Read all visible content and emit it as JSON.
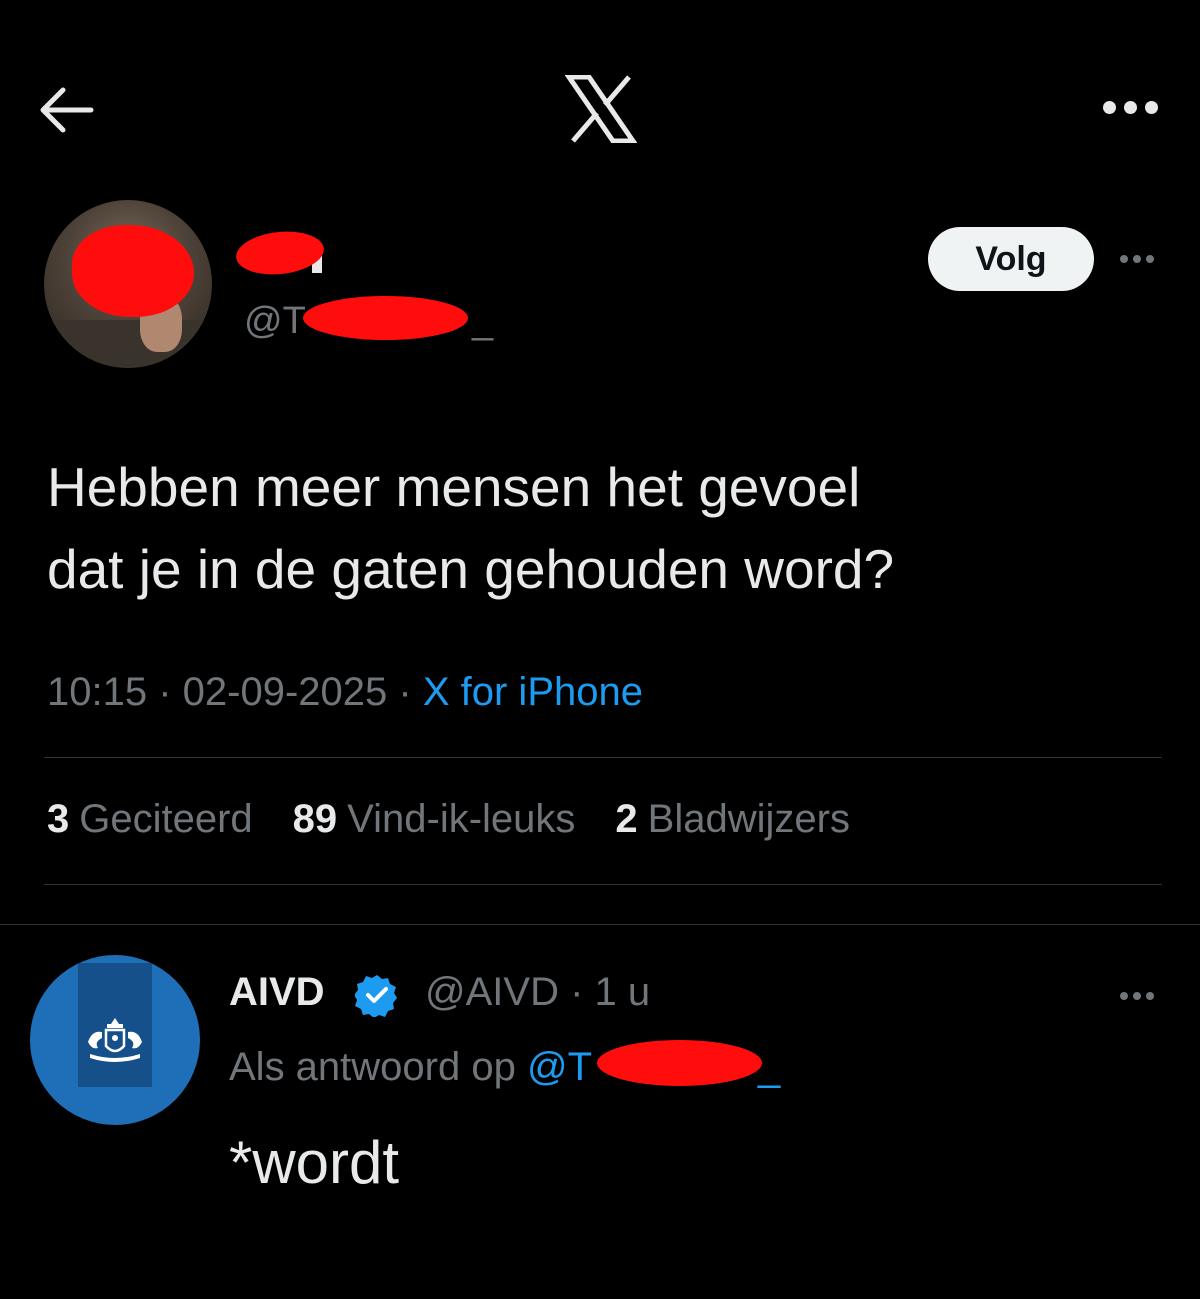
{
  "topbar": {
    "back_icon": "arrow-left-icon",
    "logo_icon": "x-logo-icon",
    "more_icon": "more-horizontal-icon"
  },
  "tweet": {
    "display_name_visible": "",
    "handle_prefix": "@T",
    "handle_suffix": "_",
    "follow_label": "Volg",
    "text_line1": "Hebben meer mensen het gevoel",
    "text_line2": "dat je in de gaten gehouden word?",
    "time": "10:15",
    "date": "02-09-2025",
    "source": "X for iPhone",
    "stats": {
      "quotes_count": "3",
      "quotes_label": "Geciteerd",
      "likes_count": "89",
      "likes_label": "Vind-ik-leuks",
      "bookmarks_count": "2",
      "bookmarks_label": "Bladwijzers"
    }
  },
  "reply": {
    "name": "AIVD",
    "handle": "@AIVD",
    "age": "1 u",
    "reply_to_label": "Als antwoord op",
    "mention_prefix": "@T",
    "mention_suffix": "_",
    "text": "*wordt"
  },
  "colors": {
    "background": "#000000",
    "text": "#e7e9ea",
    "muted": "#71767b",
    "accent": "#1d9bf0",
    "redaction": "#ff0d0d",
    "divider": "#2f3336"
  }
}
